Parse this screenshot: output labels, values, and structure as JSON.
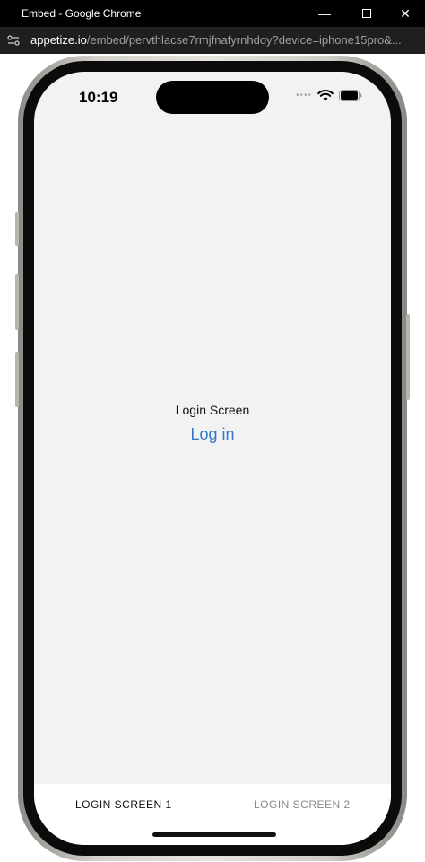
{
  "browser": {
    "window_title": "Embed - Google Chrome",
    "url_host": "appetize.io",
    "url_path": "/embed/pervthlacse7rmjfnafyrnhdoy?device=iphone15pro&..."
  },
  "status_bar": {
    "time": "10:19"
  },
  "screen": {
    "label": "Login Screen",
    "login_link": "Log in"
  },
  "tabbar": {
    "tabs": [
      {
        "label": "LOGIN SCREEN 1",
        "active": true
      },
      {
        "label": "LOGIN SCREEN 2",
        "active": false
      }
    ]
  },
  "colors": {
    "link": "#3478c6",
    "screen_bg": "#f2f2f4"
  }
}
